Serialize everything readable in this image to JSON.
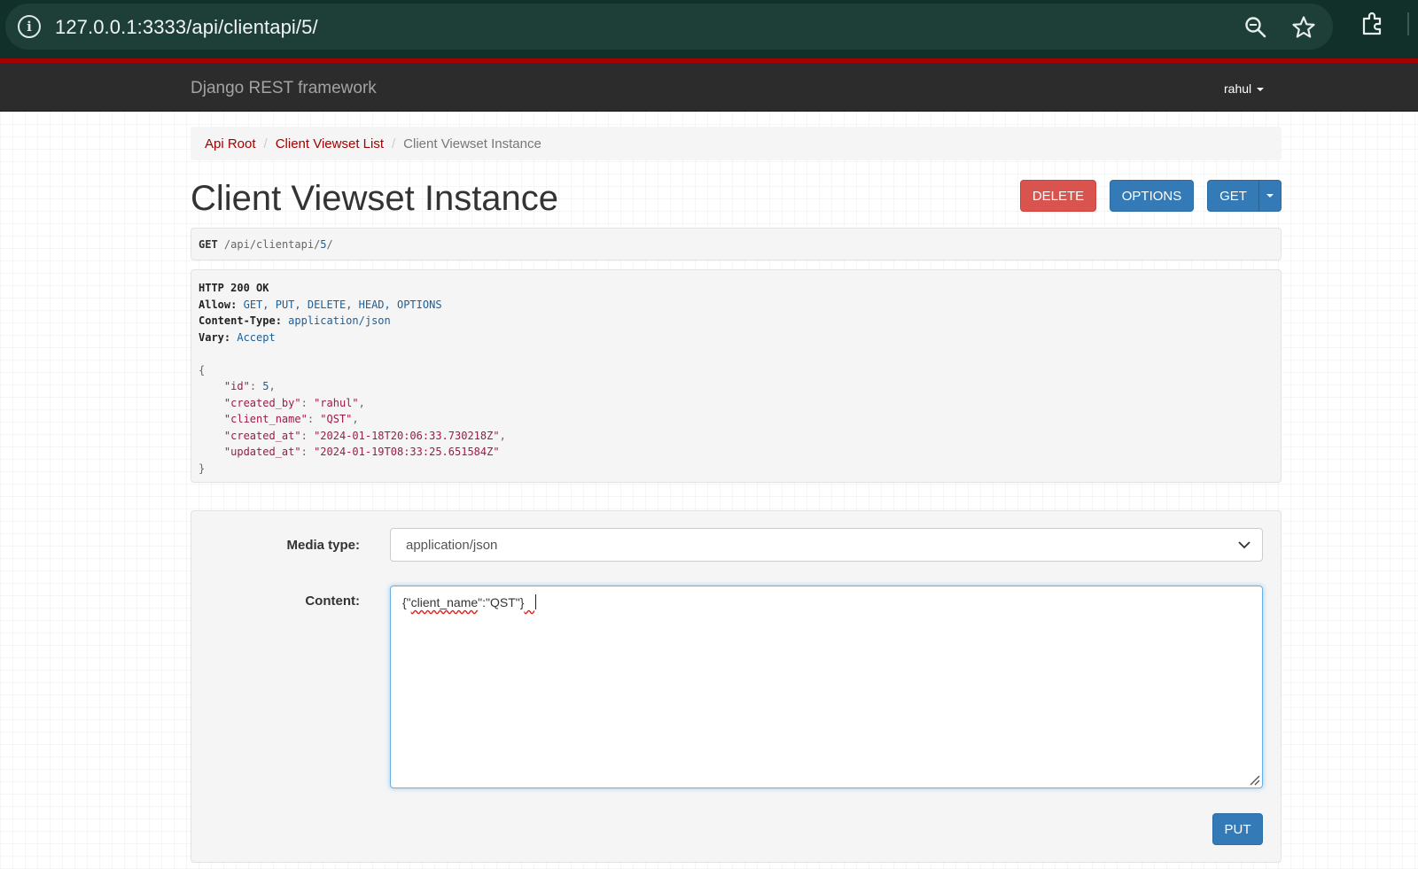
{
  "browser": {
    "url": "127.0.0.1:3333/api/clientapi/5/",
    "icons": [
      "info-icon",
      "zoom-icon",
      "star-icon",
      "extensions-icon"
    ]
  },
  "navbar": {
    "brand": "Django REST framework",
    "user": "rahul"
  },
  "breadcrumb": {
    "items": [
      "Api Root",
      "Client Viewset List",
      "Client Viewset Instance"
    ],
    "separator": "/"
  },
  "page": {
    "title": "Client Viewset Instance"
  },
  "actions": {
    "delete": "DELETE",
    "options": "OPTIONS",
    "get": "GET"
  },
  "request": {
    "method": "GET",
    "path_prefix": "/api/clientapi/",
    "path_id": "5",
    "path_suffix": "/"
  },
  "response": {
    "status": "HTTP 200 OK",
    "headers": [
      {
        "name": "Allow:",
        "value": "GET, PUT, DELETE, HEAD, OPTIONS"
      },
      {
        "name": "Content-Type:",
        "value": "application/json"
      },
      {
        "name": "Vary:",
        "value": "Accept"
      }
    ],
    "body_open": "{",
    "body_close": "}",
    "body": [
      {
        "key": "\"id\"",
        "value": "5",
        "type": "number"
      },
      {
        "key": "\"created_by\"",
        "value": "\"rahul\"",
        "type": "string"
      },
      {
        "key": "\"client_name\"",
        "value": "\"QST\"",
        "type": "string"
      },
      {
        "key": "\"created_at\"",
        "value": "\"2024-01-18T20:06:33.730218Z\"",
        "type": "string"
      },
      {
        "key": "\"updated_at\"",
        "value": "\"2024-01-19T08:33:25.651584Z\"",
        "type": "string"
      }
    ]
  },
  "form": {
    "media_type_label": "Media type:",
    "media_type_value": "application/json",
    "content_label": "Content:",
    "content_value_a": "{\"",
    "content_value_misspelled": "client_name",
    "content_value_b": "\":\"QST\"}",
    "put_label": "PUT"
  },
  "colors": {
    "delete": "#d9534f",
    "primary": "#337ab7",
    "link": "#a30000",
    "navbar": "#2c2c2c",
    "browser_bar": "#12302a"
  }
}
